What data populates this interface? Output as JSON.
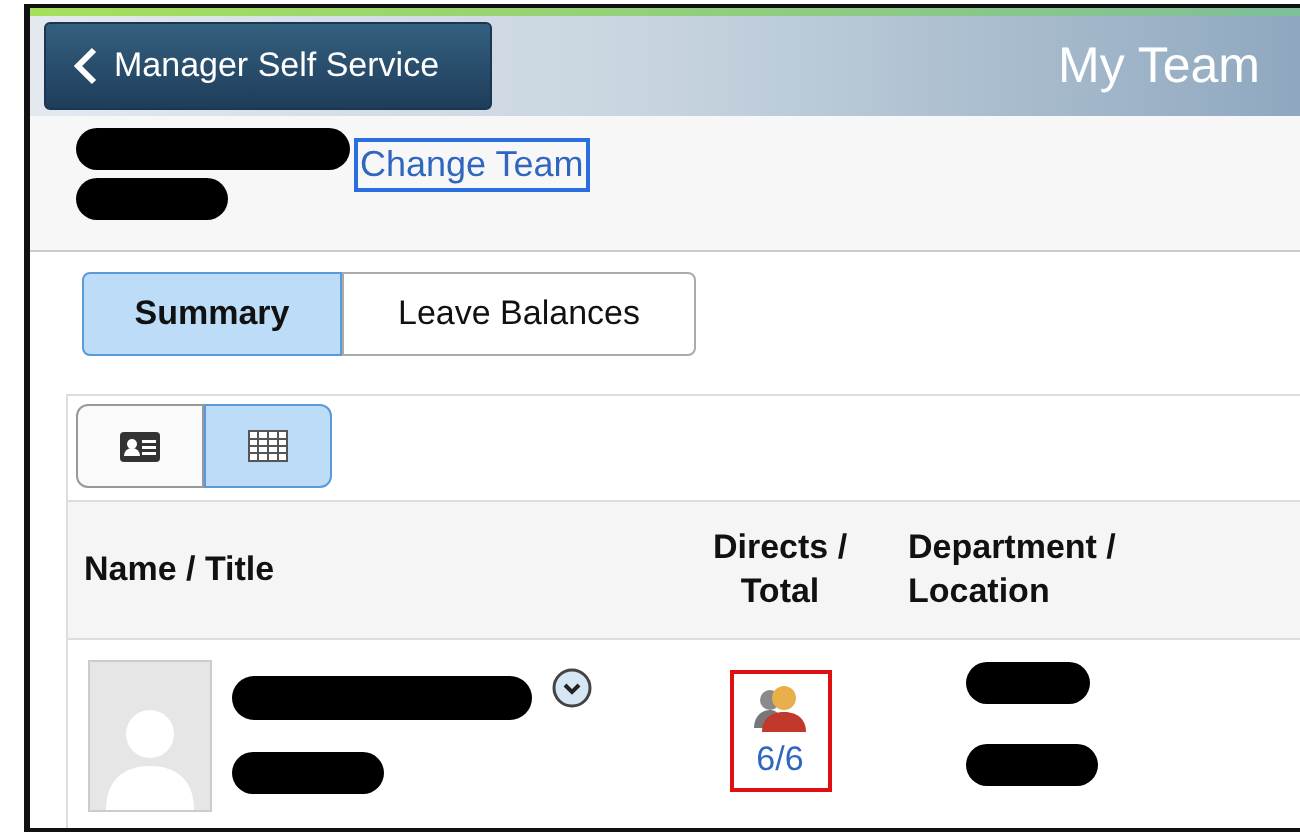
{
  "header": {
    "back_button": "Manager Self Service",
    "title": "My Team"
  },
  "team": {
    "link": "Change Team"
  },
  "tabs": [
    {
      "label": "Summary",
      "selected": true
    },
    {
      "label": "Leave Balances",
      "selected": false
    }
  ],
  "view_toggle": [
    {
      "kind": "card",
      "selected": false
    },
    {
      "kind": "grid",
      "selected": true
    }
  ],
  "table": {
    "columns": [
      "Name / Title",
      "Directs / Total",
      "Department / Location"
    ],
    "rows": [
      {
        "directs": "6/6",
        "highlighted": true
      }
    ]
  }
}
